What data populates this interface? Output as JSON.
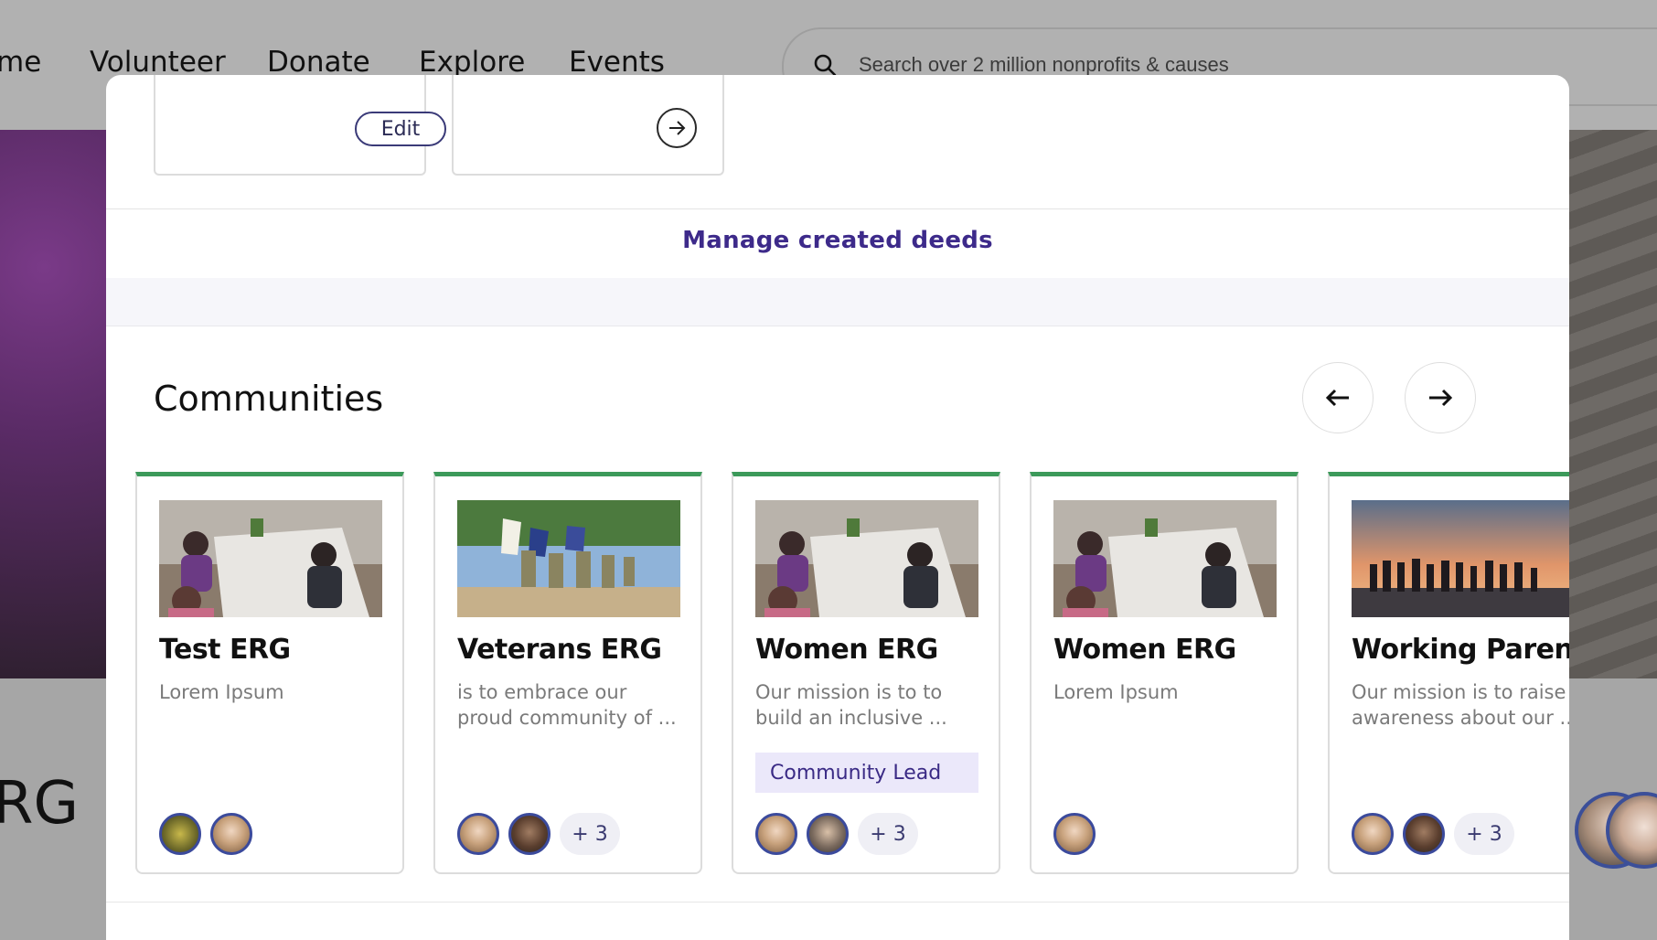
{
  "background_nav": {
    "items": [
      "me",
      "Volunteer",
      "Donate",
      "Explore",
      "Events"
    ],
    "search_placeholder": "Search over 2 million nonprofits & causes"
  },
  "background_page": {
    "title_fragment": "RG"
  },
  "modal": {
    "deed_cards": [
      {
        "action_label": "Edit"
      },
      {
        "action_icon": "arrow-right-circle-icon"
      }
    ],
    "manage_link": "Manage created deeds",
    "communities": {
      "title": "Communities",
      "prev_icon": "arrow-left-icon",
      "next_icon": "arrow-right-icon",
      "cards": [
        {
          "name": "Test ERG",
          "description": "Lorem Ipsum",
          "badge": "",
          "member_count_extra": "",
          "image": "office-meeting"
        },
        {
          "name": "Veterans ERG",
          "description": "is to embrace our proud community of ...",
          "badge": "",
          "member_count_extra": "+ 3",
          "image": "veterans-parade"
        },
        {
          "name": "Women ERG",
          "description": "Our mission is to to build an inclusive ...",
          "badge": "Community Lead",
          "member_count_extra": "+ 3",
          "image": "office-meeting"
        },
        {
          "name": "Women ERG",
          "description": "Lorem Ipsum",
          "badge": "",
          "member_count_extra": "",
          "image": "office-meeting"
        },
        {
          "name": "Working Paren...",
          "description": "Our mission is to raise awareness about our ...",
          "badge": "",
          "member_count_extra": "+ 3",
          "image": "sunset-beach-group"
        }
      ]
    }
  },
  "colors": {
    "accent_green": "#3c9a5a",
    "link_purple": "#3d2a8a",
    "avatar_ring": "#3b4a9c",
    "badge_bg": "#ebe8fa"
  }
}
